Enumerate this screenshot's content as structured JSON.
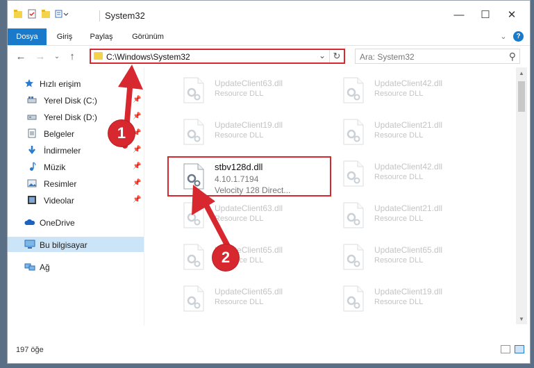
{
  "window": {
    "title": "System32",
    "minimize_label": "—",
    "maximize_label": "☐",
    "close_label": "✕"
  },
  "ribbon": {
    "tabs": [
      {
        "label": "Dosya",
        "active": true
      },
      {
        "label": "Giriş"
      },
      {
        "label": "Paylaş"
      },
      {
        "label": "Görünüm"
      }
    ],
    "expand_label": "⌄",
    "help_label": "?"
  },
  "address": {
    "path": "C:\\Windows\\System32",
    "dropdown": "⌄",
    "refresh": "↻"
  },
  "search": {
    "placeholder": "Ara: System32",
    "icon_glyph": "⚲"
  },
  "nav": {
    "back": "←",
    "forward": "→",
    "recent": "⌄",
    "up": "↑"
  },
  "sidebar": {
    "items": [
      {
        "label": "Hızlı erişim",
        "icon": "star-icon",
        "pinned": false
      },
      {
        "label": "Yerel Disk (C:)",
        "icon": "drive-icon",
        "pinned": true
      },
      {
        "label": "Yerel Disk (D:)",
        "icon": "drive-icon",
        "pinned": true
      },
      {
        "label": "Belgeler",
        "icon": "document-icon",
        "pinned": true
      },
      {
        "label": "İndirmeler",
        "icon": "download-icon",
        "pinned": true
      },
      {
        "label": "Müzik",
        "icon": "music-icon",
        "pinned": true
      },
      {
        "label": "Resimler",
        "icon": "pictures-icon",
        "pinned": true
      },
      {
        "label": "Videolar",
        "icon": "video-icon",
        "pinned": true
      },
      {
        "label": "OneDrive",
        "icon": "cloud-icon",
        "pinned": false
      },
      {
        "label": "Bu bilgisayar",
        "icon": "computer-icon",
        "pinned": false,
        "selected": true
      },
      {
        "label": "Ağ",
        "icon": "network-icon",
        "pinned": false
      }
    ],
    "pin_glyph": "📌"
  },
  "files": {
    "left": [
      {
        "name": "UpdateClient63.dll",
        "type": "Resource DLL"
      },
      {
        "name": "UpdateClient19.dll",
        "type": "Resource DLL"
      },
      {
        "name": "stbv128d.dll",
        "type": "4.10.1.7194",
        "type2": "Velocity 128 Direct...",
        "highlight": true
      },
      {
        "name": "UpdateClient63.dll",
        "type": "Resource DLL"
      },
      {
        "name": "UpdateClient65.dll",
        "type": "Resource DLL"
      },
      {
        "name": "UpdateClient65.dll",
        "type": "Resource DLL"
      }
    ],
    "right": [
      {
        "name": "UpdateClient42.dll",
        "type": "Resource DLL"
      },
      {
        "name": "UpdateClient21.dll",
        "type": "Resource DLL"
      },
      {
        "name": "UpdateClient42.dll",
        "type": "Resource DLL"
      },
      {
        "name": "UpdateClient21.dll",
        "type": "Resource DLL"
      },
      {
        "name": "UpdateClient65.dll",
        "type": "Resource DLL"
      },
      {
        "name": "UpdateClient19.dll",
        "type": "Resource DLL"
      }
    ]
  },
  "status": {
    "count": "197 öğe"
  },
  "annotations": {
    "badge1": "1",
    "badge2": "2",
    "color": "#d7282f"
  }
}
